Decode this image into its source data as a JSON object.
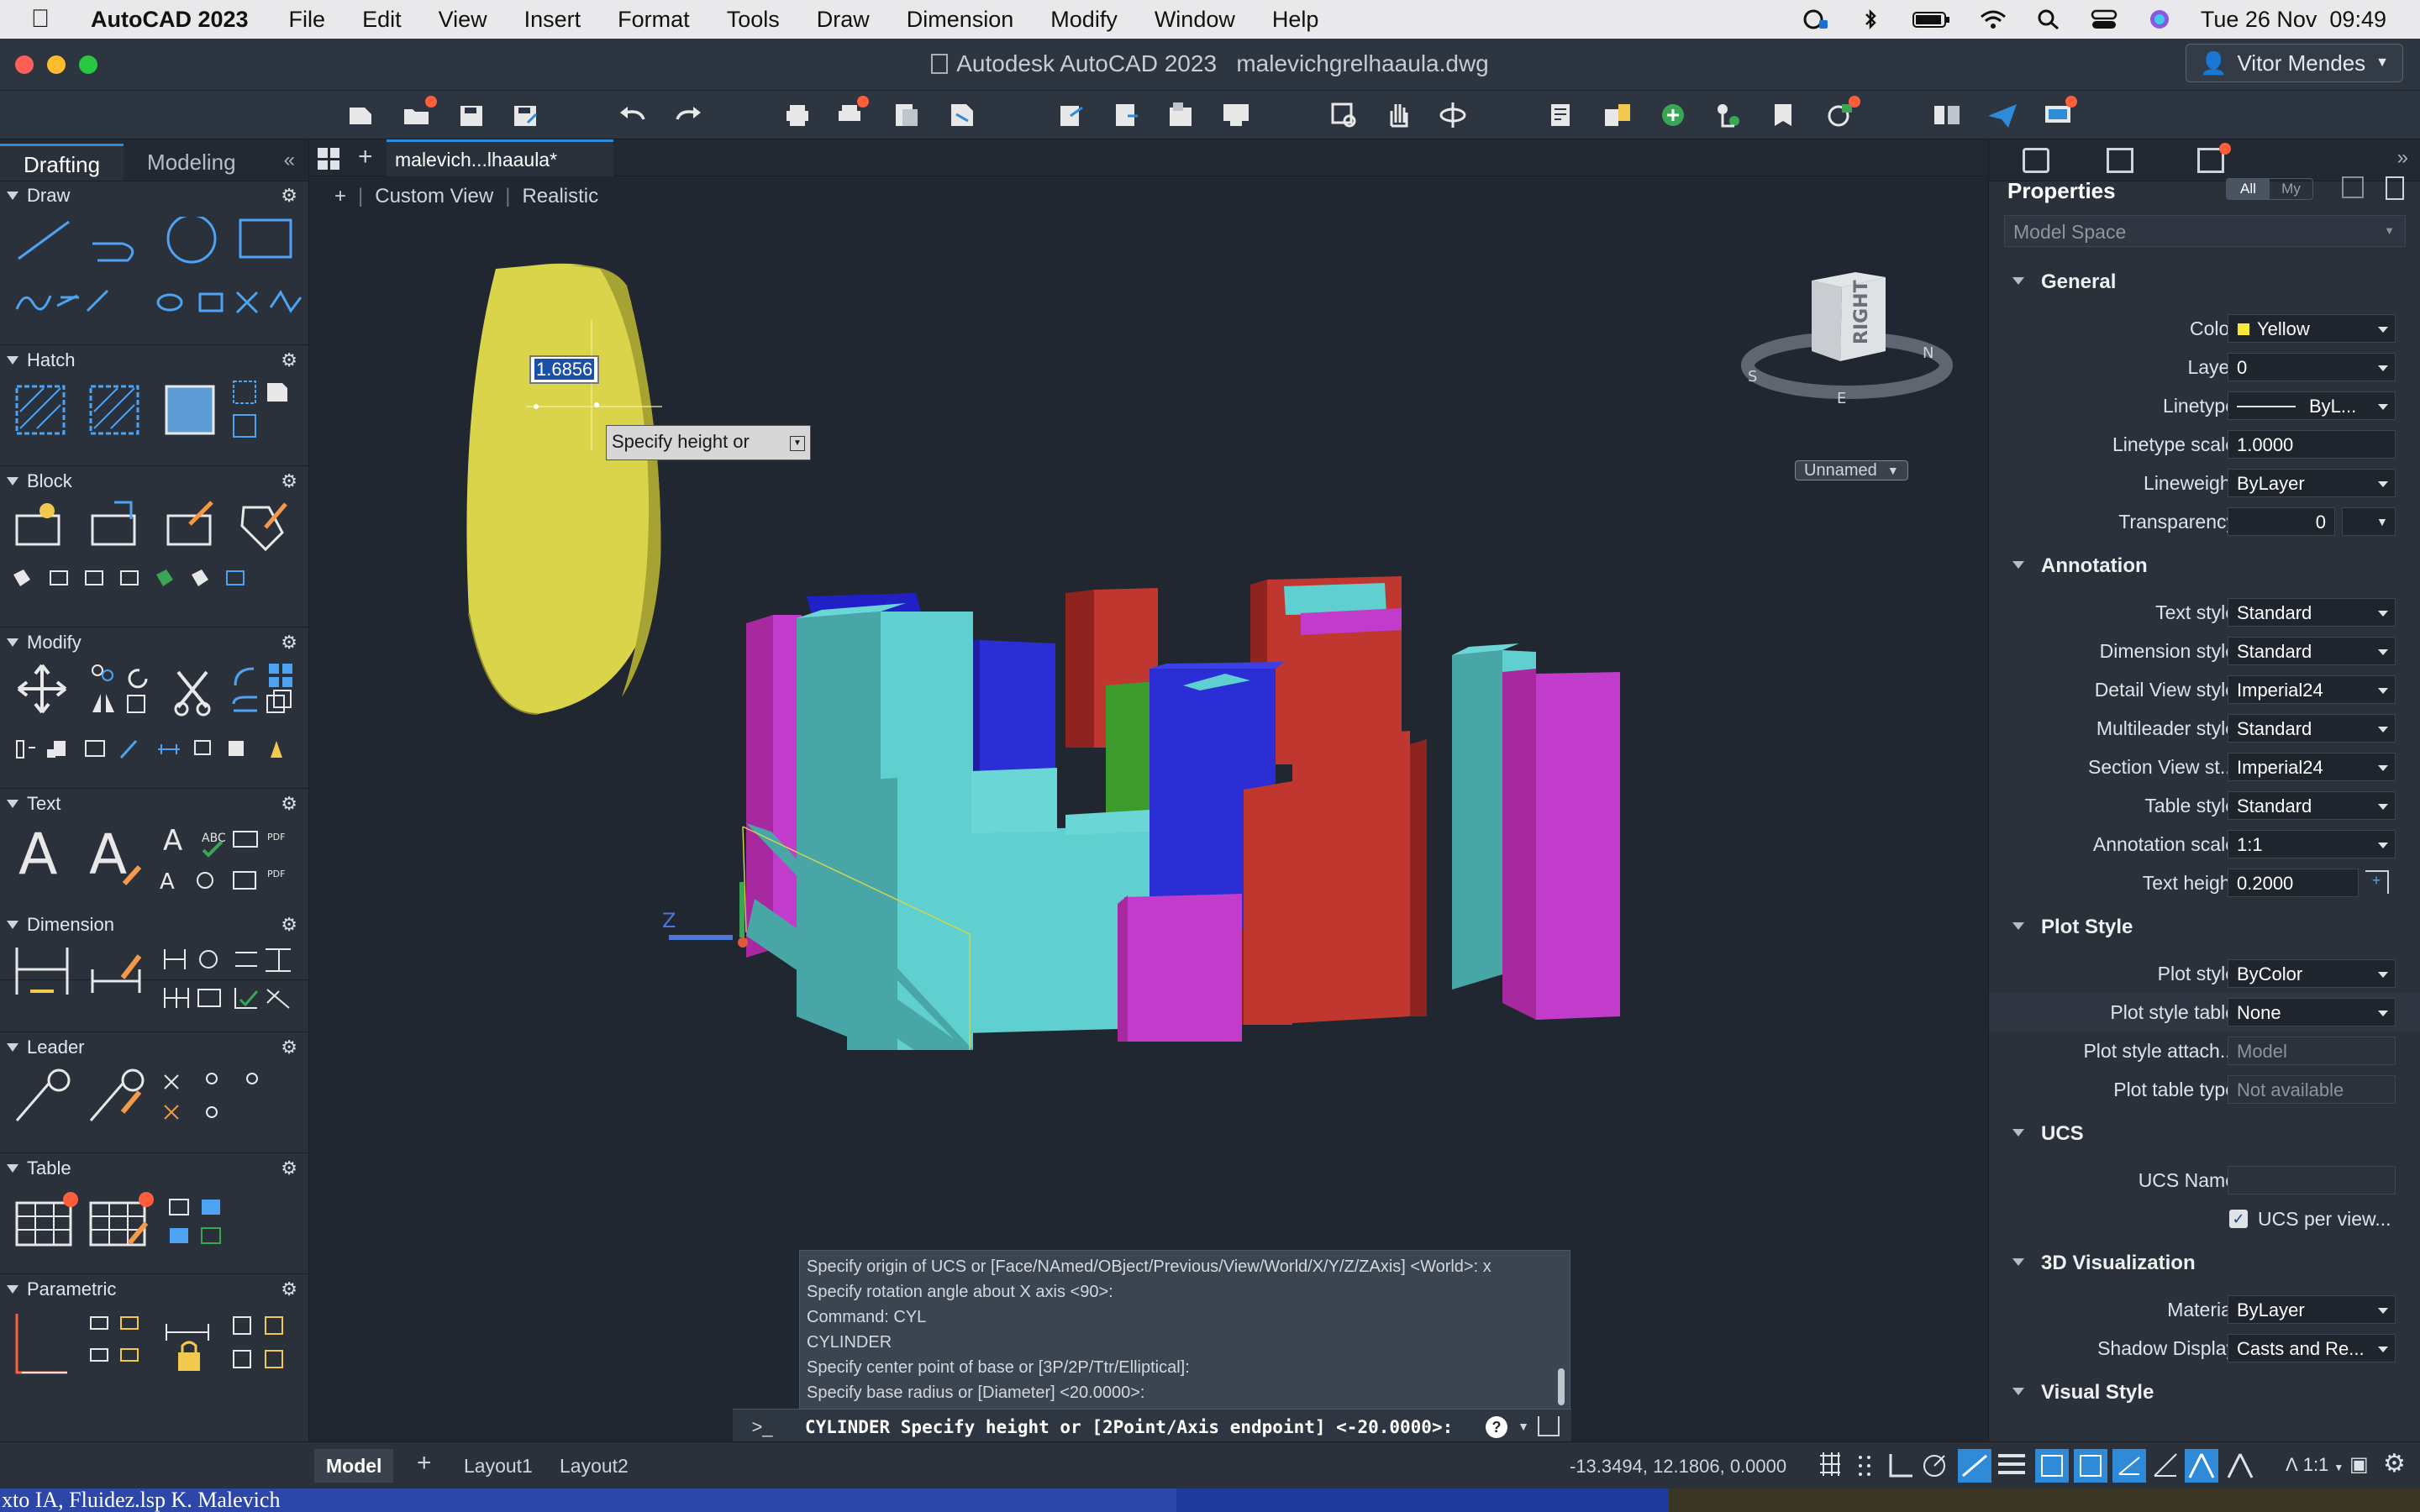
{
  "menubar": {
    "app_name": "AutoCAD 2023",
    "items": [
      "File",
      "Edit",
      "View",
      "Insert",
      "Format",
      "Tools",
      "Draw",
      "Dimension",
      "Modify",
      "Window",
      "Help"
    ],
    "datetime": "Tue 26 Nov  09:49"
  },
  "window": {
    "title": "Autodesk AutoCAD 2023   malevichgrelhaaula.dwg",
    "user": "Vitor Mendes"
  },
  "left_panel": {
    "tabs": [
      "Drafting",
      "Modeling"
    ],
    "sections": [
      "Draw",
      "Hatch",
      "Block",
      "Modify",
      "Text",
      "Dimension",
      "Leader",
      "Table",
      "Parametric"
    ]
  },
  "doc_tab": {
    "label": "malevich...lhaaula*"
  },
  "viewport": {
    "view_name": "Custom View",
    "visual_style": "Realistic",
    "dynamic_input_value": "1.6856",
    "tooltip": "Specify height or",
    "viewcube_face": "RIGHT",
    "ucs_name_dropdown": "Unnamed",
    "axis_label": "Z"
  },
  "command": {
    "history": [
      "Specify origin of UCS or [Face/NAmed/OBject/Previous/View/World/X/Y/Z/ZAxis] <World>: x",
      "Specify rotation angle about X axis <90>:",
      "Command: CYL",
      "CYLINDER",
      "Specify center point of base or [3P/2P/Ttr/Elliptical]:",
      "Specify base radius or [Diameter] <20.0000>:"
    ],
    "prompt_symbol": ">_",
    "current": "CYLINDER Specify height or [2Point/Axis endpoint] <-20.0000>:"
  },
  "properties": {
    "title": "Properties",
    "filter_all": "All",
    "filter_my": "My",
    "space": "Model Space",
    "groups": {
      "general": "General",
      "annotation": "Annotation",
      "plot_style": "Plot Style",
      "ucs": "UCS",
      "visualization": "3D Visualization",
      "visual_style": "Visual Style"
    },
    "rows": {
      "color": {
        "label": "Color",
        "value": "Yellow"
      },
      "layer": {
        "label": "Layer",
        "value": "0"
      },
      "linetype": {
        "label": "Linetype",
        "value": "ByL..."
      },
      "linetype_scale": {
        "label": "Linetype scale",
        "value": "1.0000"
      },
      "lineweight": {
        "label": "Lineweight",
        "value": "ByLayer"
      },
      "transparency": {
        "label": "Transparency",
        "value": "0"
      },
      "text_style": {
        "label": "Text style",
        "value": "Standard"
      },
      "dimension_style": {
        "label": "Dimension style",
        "value": "Standard"
      },
      "detail_view_style": {
        "label": "Detail View style",
        "value": "Imperial24"
      },
      "multileader_style": {
        "label": "Multileader style",
        "value": "Standard"
      },
      "section_view_style": {
        "label": "Section View st...",
        "value": "Imperial24"
      },
      "table_style": {
        "label": "Table style",
        "value": "Standard"
      },
      "annotation_scale": {
        "label": "Annotation scale",
        "value": "1:1"
      },
      "text_height": {
        "label": "Text height",
        "value": "0.2000"
      },
      "plot_style": {
        "label": "Plot style",
        "value": "ByColor"
      },
      "plot_style_table": {
        "label": "Plot style table",
        "value": "None"
      },
      "plot_style_attach": {
        "label": "Plot style attach...",
        "value": "Model"
      },
      "plot_table_type": {
        "label": "Plot table type",
        "value": "Not available"
      },
      "ucs_name": {
        "label": "UCS Name",
        "value": ""
      },
      "ucs_per_view": {
        "label": "UCS per view...",
        "checked": true
      },
      "material": {
        "label": "Material",
        "value": "ByLayer"
      },
      "shadow_display": {
        "label": "Shadow Display",
        "value": "Casts and Re..."
      }
    }
  },
  "statusbar": {
    "tabs": [
      "Model",
      "Layout1",
      "Layout2"
    ],
    "coords": "-13.3494, 12.1806, 0.0000",
    "scale": "1:1"
  },
  "bottom_strip": {
    "text": "xto IA, Fluidez.lsp K. Malevich"
  },
  "colors": {
    "accent": "#2f8ad8",
    "yellow": "#e0dd43",
    "cyan": "#5fcfcf",
    "blue": "#2a2ed4",
    "red": "#c0372f",
    "magenta": "#c23ccb",
    "green": "#3d9a2c"
  }
}
